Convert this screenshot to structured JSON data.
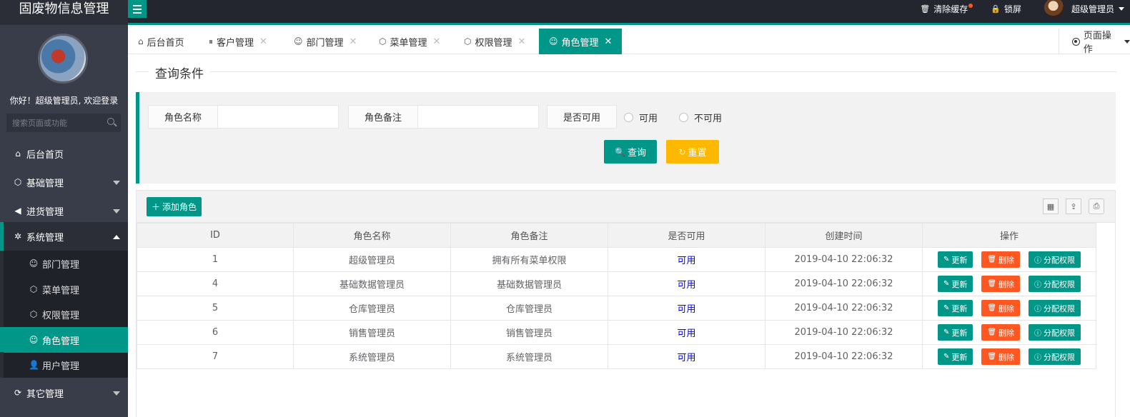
{
  "app": {
    "brand": "固废物信息管理",
    "clear_cache": "清除缓存",
    "lock_screen": "锁屏",
    "user_name": "超级管理员"
  },
  "sidebar": {
    "welcome": "你好！超级管理员, 欢迎登录",
    "search_placeholder": "搜索页面或功能",
    "items": [
      {
        "label": "后台首页",
        "icon": "home-icon"
      },
      {
        "label": "基础管理",
        "icon": "cube-icon"
      },
      {
        "label": "进货管理",
        "icon": "speaker-icon"
      },
      {
        "label": "系统管理",
        "icon": "gear-icon"
      },
      {
        "label": "其它管理",
        "icon": "circle-arrow-icon"
      }
    ],
    "sub_items": [
      {
        "label": "部门管理",
        "icon": "user-outline-icon"
      },
      {
        "label": "菜单管理",
        "icon": "cube-icon"
      },
      {
        "label": "权限管理",
        "icon": "cube-icon"
      },
      {
        "label": "角色管理",
        "icon": "smile-icon"
      },
      {
        "label": "用户管理",
        "icon": "user-icon"
      }
    ]
  },
  "tabs": [
    {
      "label": "后台首页",
      "icon": "home-icon"
    },
    {
      "label": "客户管理",
      "icon": "pause-icon"
    },
    {
      "label": "部门管理",
      "icon": "user-outline-icon"
    },
    {
      "label": "菜单管理",
      "icon": "cube-icon"
    },
    {
      "label": "权限管理",
      "icon": "cube-icon"
    },
    {
      "label": "角色管理",
      "icon": "smile-icon"
    }
  ],
  "page_ops": "页面操作",
  "query": {
    "legend": "查询条件",
    "role_name_label": "角色名称",
    "role_remark_label": "角色备注",
    "available_label": "是否可用",
    "option_yes": "可用",
    "option_no": "不可用",
    "search_button": "查询",
    "reset_button": "重置"
  },
  "table": {
    "add_button": "添加角色",
    "columns": [
      "ID",
      "角色名称",
      "角色备注",
      "是否可用",
      "创建时间",
      "操作"
    ],
    "rows": [
      {
        "id": "1",
        "name": "超级管理员",
        "remark": "拥有所有菜单权限",
        "available": "可用",
        "created": "2019-04-10 22:06:32"
      },
      {
        "id": "4",
        "name": "基础数据管理员",
        "remark": "基础数据管理员",
        "available": "可用",
        "created": "2019-04-10 22:06:32"
      },
      {
        "id": "5",
        "name": "仓库管理员",
        "remark": "仓库管理员",
        "available": "可用",
        "created": "2019-04-10 22:06:32"
      },
      {
        "id": "6",
        "name": "销售管理员",
        "remark": "销售管理员",
        "available": "可用",
        "created": "2019-04-10 22:06:32"
      },
      {
        "id": "7",
        "name": "系统管理员",
        "remark": "系统管理员",
        "available": "可用",
        "created": "2019-04-10 22:06:32"
      }
    ],
    "edit_label": "更新",
    "delete_label": "删除",
    "permission_label": "分配权限"
  },
  "colors": {
    "accent": "#009688",
    "danger": "#ff5722",
    "warning": "#ffb800",
    "sidebar": "#393d49"
  }
}
